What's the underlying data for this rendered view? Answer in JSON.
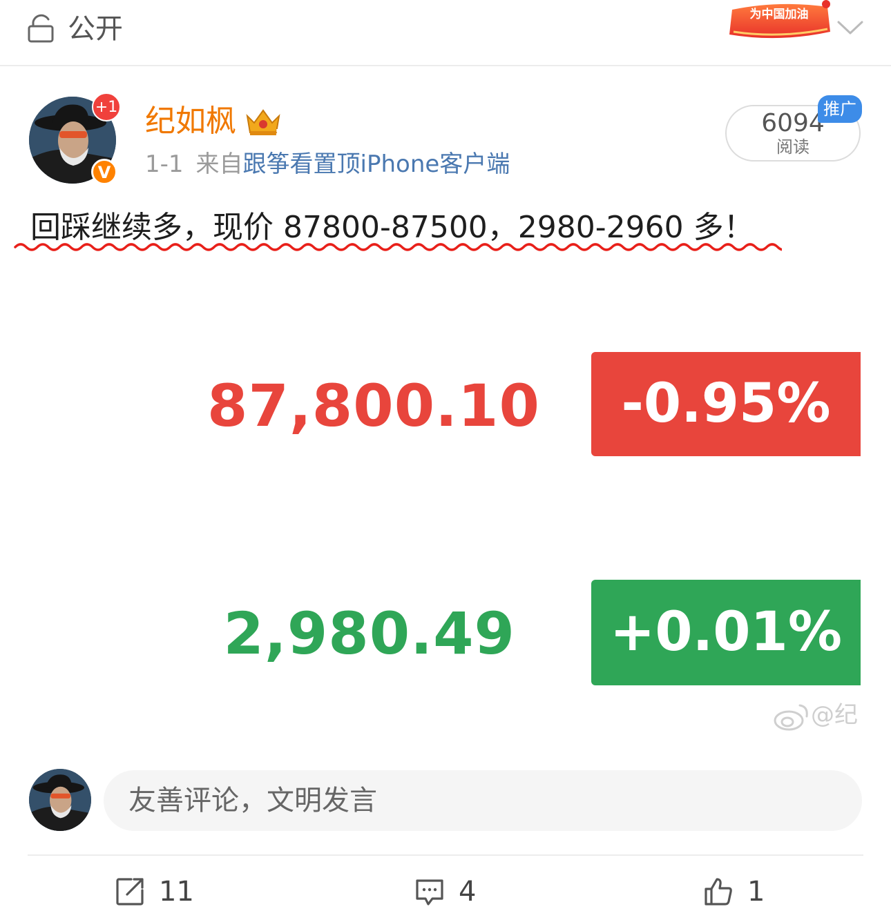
{
  "top_bar": {
    "privacy_label": "公开",
    "promo_badge_text": "为中国加油"
  },
  "author": {
    "name": "纪如枫",
    "notification_badge": "+1",
    "verified_mark": "V",
    "date": "1-1",
    "from_label": "来自",
    "source": "跟筝看置顶iPhone客户端"
  },
  "reads": {
    "count": "6094",
    "label": "阅读",
    "promo_tag": "推广"
  },
  "post": {
    "text": "回踩继续多，现价 87800-87500，2980-2960 多！"
  },
  "quotes": [
    {
      "price": "87,800.10",
      "change": "-0.95%",
      "color": "#e8453c"
    },
    {
      "price": "2,980.49",
      "change": "+0.01%",
      "color": "#2fa657"
    }
  ],
  "watermark": "@纪",
  "comment_box": {
    "placeholder": "友善评论，文明发言"
  },
  "actions": {
    "repost_count": "11",
    "comment_count": "4",
    "like_count": "1"
  },
  "colors": {
    "username": "#f07800",
    "link": "#4a78b0",
    "down": "#e8453c",
    "up": "#2fa657",
    "promo": "#3d8ce8"
  }
}
